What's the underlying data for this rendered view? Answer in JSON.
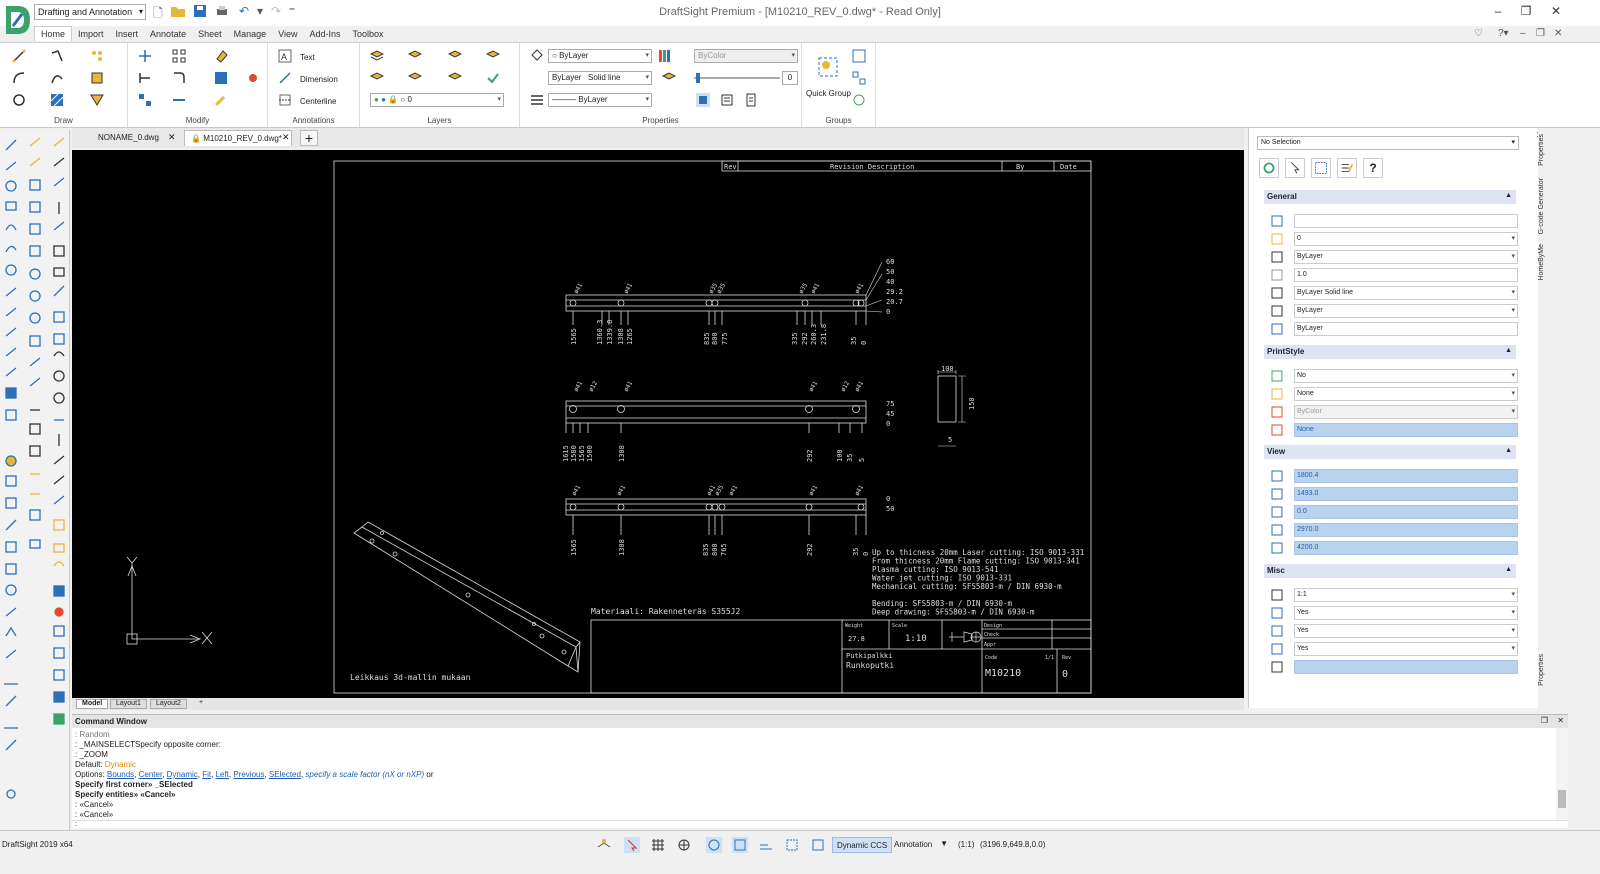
{
  "app": {
    "title": "DraftSight Premium - [M10210_REV_0.dwg* - Read Only]",
    "workspace": "Drafting and Annotation",
    "version_label": "DraftSight 2019 x64"
  },
  "ribbon": {
    "tabs": [
      "Home",
      "Import",
      "Insert",
      "Annotate",
      "Sheet",
      "Manage",
      "View",
      "Add-Ins",
      "Toolbox"
    ],
    "groups": {
      "draw": "Draw",
      "modify": "Modify",
      "annotations": "Annotations",
      "layers": "Layers",
      "properties": "Properties",
      "groups": "Groups"
    },
    "annotations": {
      "text": "Text",
      "dimension": "Dimension",
      "centerline": "Centerline"
    },
    "layers": {
      "layer_value": "0"
    },
    "properties": {
      "color": "ByLayer",
      "linestyle_layer": "ByLayer",
      "linestyle": "Solid line",
      "lineweight": "ByLayer",
      "printstyle": "ByColor",
      "transparency": "0"
    },
    "quick_group": "Quick Group"
  },
  "doc_tabs": [
    "NONAME_0.dwg",
    "M10210_REV_0.dwg*"
  ],
  "layout_tabs": [
    "Model",
    "Layout1",
    "Layout2"
  ],
  "drawing": {
    "rev_header": [
      "Rev",
      "Revision Description",
      "By",
      "Date"
    ],
    "beam1_dims_right": [
      "60",
      "50",
      "40",
      "29.2",
      "20.7",
      "0"
    ],
    "beam1_dims_bottom": [
      "1565",
      "1360.3",
      "1339.8",
      "1308",
      "1265",
      "835",
      "800",
      "775",
      "335",
      "292",
      "260.3",
      "231.8",
      "35",
      "0"
    ],
    "beam1_holes": [
      "ø41",
      "ø41",
      "ø35",
      "ø35",
      "ø35",
      "ø41",
      "ø41"
    ],
    "beam2_dims_right": [
      "75",
      "45",
      "0"
    ],
    "beam2_dims_bottom": [
      "1615",
      "1580",
      "1565",
      "1500",
      "1308",
      "292",
      "100",
      "35",
      "5"
    ],
    "beam2_holes": [
      "ø41",
      "ø12",
      "ø41",
      "ø41",
      "ø12",
      "ø41"
    ],
    "beam3_dims_right": [
      "0",
      "50"
    ],
    "beam3_dims_bottom": [
      "1565",
      "1308",
      "835",
      "800",
      "765",
      "292",
      "35",
      "0"
    ],
    "beam3_holes": [
      "ø41",
      "ø41",
      "ø41",
      "ø35",
      "ø41",
      "ø41",
      "ø41"
    ],
    "section_dims": [
      "100",
      "150",
      "5"
    ],
    "notes": [
      "Up to thicness 20mm Laser cutting: ISO 9013-331",
      "From thicness 20mm Flame cutting: ISO 9013-341",
      "Plasma cutting: ISO 9013-541",
      "Water jet cutting: ISO 9013-331",
      "Mechanical cutting: SFS5803-m / DIN 6930-m",
      "",
      "Bending: SFS5803-m / DIN 6930-m",
      "Deep drawing: SFS5803-m / DIN 6930-m"
    ],
    "material": "Materiaali:   Rakenneteräs S355J2",
    "cut_note": "Leikkaus 3d-mallin mukaan",
    "title_block": {
      "weight_label": "Weight",
      "weight": "27.8",
      "scale_label": "Scale",
      "scale": "1:10",
      "design_label": "Design",
      "check_label": "Check",
      "appr_label": "Appr",
      "name1": "Putkipalkki",
      "name2": "Runkoputki",
      "code_label": "Code",
      "code": "M10210",
      "sheet": "1/1",
      "rev_label": "Rev",
      "rev": "0"
    },
    "ucs_x": "X",
    "ucs_y": "Y"
  },
  "properties": {
    "selection": "No Selection",
    "general_title": "General",
    "general": [
      "",
      "0",
      "ByLayer",
      "1.0",
      "ByLayer    Solid line",
      "ByLayer",
      "ByLayer"
    ],
    "printstyle_title": "PrintStyle",
    "printstyle": [
      "No",
      "None",
      "ByColor",
      "None"
    ],
    "view_title": "View",
    "view": [
      "1800.4",
      "1493.0",
      "0.0",
      "2970.0",
      "4200.0"
    ],
    "misc_title": "Misc",
    "misc": [
      "1:1",
      "Yes",
      "Yes",
      "Yes",
      ""
    ],
    "side_tabs": [
      "Properties",
      "G-code Generator",
      "HomeByMe",
      "Properties"
    ]
  },
  "command": {
    "title": "Command Window",
    "lines": [
      ": _MAINSELECTSpecify opposite corner:",
      ": _ZOOM",
      "Default: ",
      "Default_value: Dynamic",
      "Options: ",
      "Specify first corner» _SElected",
      "Specify entities» «Cancel»",
      ": «Cancel»",
      ": «Cancel»"
    ],
    "options": [
      "Bounds",
      "Center",
      "Dynamic",
      "Fit",
      "Left",
      "Previous",
      "SElected"
    ],
    "options_tail": "specify a scale factor (nX or nXP)",
    "options_end": "or",
    "prompt": ":"
  },
  "status": {
    "dynamic_ccs": "Dynamic CCS",
    "annotation": "Annotation",
    "scale": "(1:1)",
    "coords": "(3196.9,649.8,0.0)"
  }
}
